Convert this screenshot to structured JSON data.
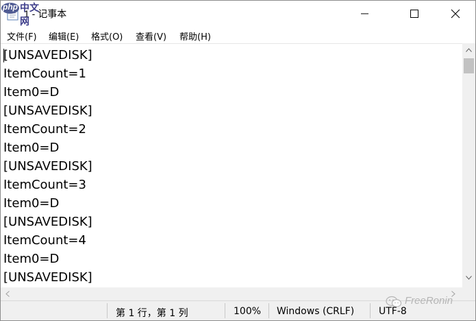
{
  "window": {
    "title": "1 - 记事本",
    "icon": "notepad-icon"
  },
  "watermark": {
    "logo_php": "php",
    "logo_cn": "中文网",
    "bottom_right": "FreeRonin",
    "bottom_right_icon": "wechat-icon"
  },
  "menu": {
    "items": [
      {
        "label": "文件(F)"
      },
      {
        "label": "编辑(E)"
      },
      {
        "label": "格式(O)"
      },
      {
        "label": "查看(V)"
      },
      {
        "label": "帮助(H)"
      }
    ]
  },
  "editor": {
    "lines": [
      "[UNSAVEDISK]",
      "ItemCount=1",
      "Item0=D",
      "[UNSAVEDISK]",
      "ItemCount=2",
      "Item0=D",
      "[UNSAVEDISK]",
      "ItemCount=3",
      "Item0=D",
      "[UNSAVEDISK]",
      "ItemCount=4",
      "Item0=D",
      "[UNSAVEDISK]"
    ]
  },
  "status": {
    "position": "第 1 行，第 1 列",
    "zoom": "100%",
    "line_ending": "Windows (CRLF)",
    "encoding": "UTF-8"
  },
  "colors": {
    "window_bg": "#ffffff",
    "chrome_bg": "#f0f0f0",
    "scroll_thumb": "#c2c2c2",
    "watermark_logo": "#4f5b93"
  }
}
